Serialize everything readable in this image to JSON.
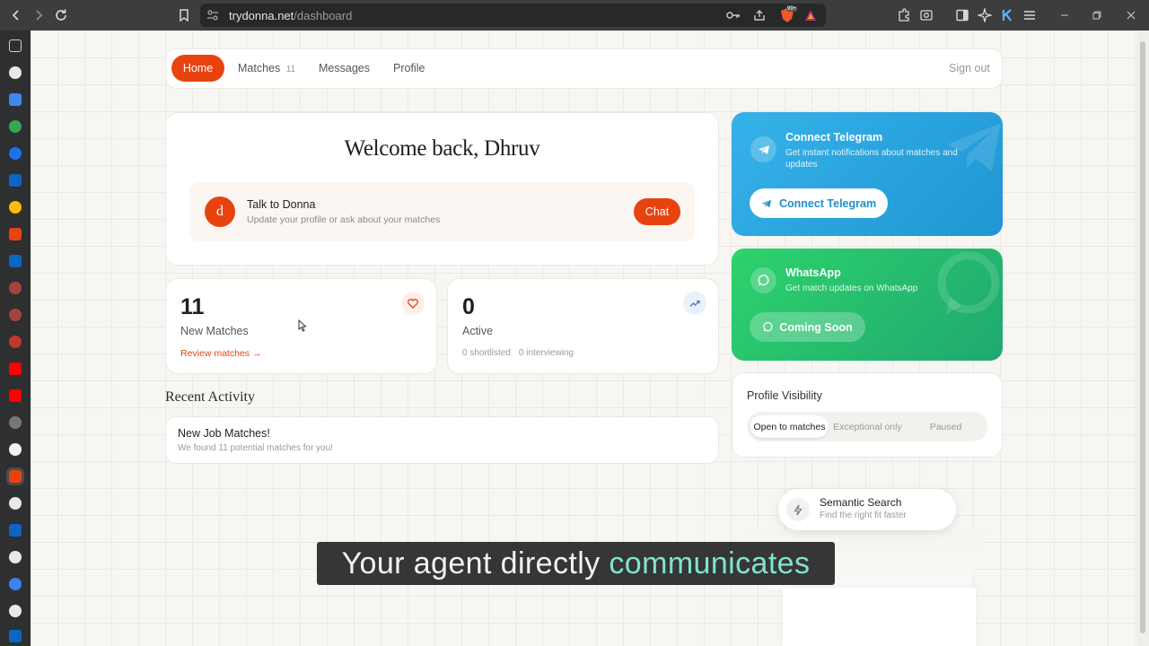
{
  "browser": {
    "url_domain": "trydonna.net",
    "url_path": "/dashboard",
    "brave_badge": "99+"
  },
  "nav": {
    "home": "Home",
    "matches": "Matches",
    "matches_count": "11",
    "messages": "Messages",
    "profile": "Profile",
    "sign_out": "Sign out"
  },
  "welcome": {
    "title": "Welcome back, Dhruv",
    "avatar_letter": "d",
    "talk_title": "Talk to Donna",
    "talk_subtitle": "Update your profile or ask about your matches",
    "chat_button": "Chat"
  },
  "stats": {
    "matches_value": "11",
    "matches_label": "New Matches",
    "review_link": "Review matches →",
    "active_value": "0",
    "active_label": "Active",
    "shortlisted": "0 shortlisted",
    "interviewing": "0 interviewing"
  },
  "activity": {
    "heading": "Recent Activity",
    "item_title": "New Job Matches!",
    "item_subtitle": "We found 11 potential matches for you!"
  },
  "telegram": {
    "title": "Connect Telegram",
    "subtitle": "Get instant notifications about matches and updates",
    "button": "Connect Telegram"
  },
  "whatsapp": {
    "title": "WhatsApp",
    "subtitle": "Get match updates on WhatsApp",
    "button": "Coming Soon"
  },
  "visibility": {
    "title": "Profile Visibility",
    "options": [
      "Open to matches",
      "Exceptional only",
      "Paused"
    ],
    "selected": "Open to matches"
  },
  "semantic": {
    "title": "Semantic Search",
    "subtitle": "Find the right fit faster"
  },
  "caption": {
    "part1": "Your agent directly ",
    "part2": "communicates"
  },
  "colors": {
    "accent": "#e8430f",
    "telegram": "#2aa3de",
    "whatsapp": "#25c068",
    "caption_highlight": "#7fe3d0"
  }
}
